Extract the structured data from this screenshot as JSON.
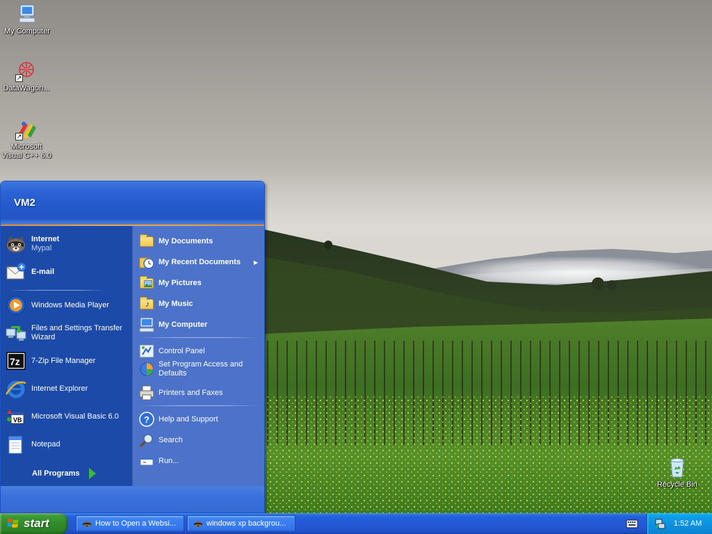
{
  "desktop": {
    "icons": [
      {
        "label": "My Computer",
        "icon": "my-computer-icon"
      },
      {
        "label": "DataWagon...",
        "icon": "datawagon-icon"
      },
      {
        "label": "Microsoft Visual C++ 6.0",
        "icon": "visual-cpp-icon"
      },
      {
        "label": "Recycle Bin",
        "icon": "recycle-bin-icon"
      }
    ]
  },
  "start_menu": {
    "user_name": "VM2",
    "left": {
      "pinned": [
        {
          "label": "Internet",
          "sub": "Mypal",
          "icon": "mypal-raccoon-icon"
        },
        {
          "label": "E-mail",
          "icon": "email-icon"
        }
      ],
      "recent": [
        {
          "label": "Windows Media Player",
          "icon": "media-player-icon"
        },
        {
          "label": "Files and Settings Transfer Wizard",
          "icon": "transfer-wizard-icon"
        },
        {
          "label": "7-Zip File Manager",
          "icon": "7zip-icon"
        },
        {
          "label": "Internet Explorer",
          "icon": "internet-explorer-icon"
        },
        {
          "label": "Microsoft Visual Basic 6.0",
          "icon": "visual-basic-icon"
        },
        {
          "label": "Notepad",
          "icon": "notepad-icon"
        }
      ],
      "all_programs": "All Programs"
    },
    "right": {
      "places": [
        {
          "label": "My Documents",
          "icon": "folder-icon"
        },
        {
          "label": "My Recent Documents",
          "icon": "recent-documents-icon",
          "submenu": true
        },
        {
          "label": "My Pictures",
          "icon": "folder-icon"
        },
        {
          "label": "My Music",
          "icon": "folder-icon"
        },
        {
          "label": "My Computer",
          "icon": "my-computer-icon"
        }
      ],
      "settings": [
        {
          "label": "Control Panel",
          "icon": "control-panel-icon"
        },
        {
          "label": "Set Program Access and Defaults",
          "icon": "program-access-icon"
        },
        {
          "label": "Printers and Faxes",
          "icon": "printer-icon"
        }
      ],
      "help": [
        {
          "label": "Help and Support",
          "icon": "help-icon"
        },
        {
          "label": "Search",
          "icon": "search-icon"
        },
        {
          "label": "Run...",
          "icon": "run-icon"
        }
      ]
    }
  },
  "taskbar": {
    "start_label": "start",
    "tasks": [
      {
        "label": "How to Open a Websi...",
        "icon": "mypal-raccoon-icon"
      },
      {
        "label": "windows xp backgrou...",
        "icon": "mypal-raccoon-icon"
      }
    ],
    "clock": "1:52 AM"
  },
  "colors": {
    "taskbar_blue": "#245edb",
    "start_green": "#318a2b",
    "menu_left_blue": "#1c4aa8",
    "menu_right_blue": "#4c72c9",
    "tray_blue": "#0c8fde"
  }
}
